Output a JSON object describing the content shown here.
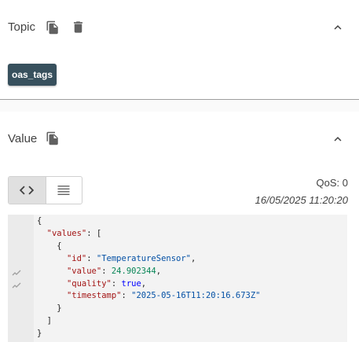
{
  "topic": {
    "title": "Topic",
    "chip": "oas_tags"
  },
  "value": {
    "title": "Value",
    "qos": "QoS: 0",
    "timestamp": "16/05/2025 11:20:20",
    "json": {
      "key_values": "\"values\"",
      "key_id": "\"id\"",
      "val_id": "\"TemperatureSensor\"",
      "key_value": "\"value\"",
      "val_value": "24.902344",
      "key_quality": "\"quality\"",
      "val_quality": "true",
      "key_timestamp": "\"timestamp\"",
      "val_timestamp": "\"2025-05-16T11:20:16.673Z\""
    }
  },
  "colors": {
    "chip_bg": "#37505d",
    "icon": "#616161"
  },
  "icons": [
    "copy-icon",
    "delete-icon",
    "chevron-up-icon",
    "code-view-icon",
    "list-view-icon",
    "sparkline-icon"
  ]
}
